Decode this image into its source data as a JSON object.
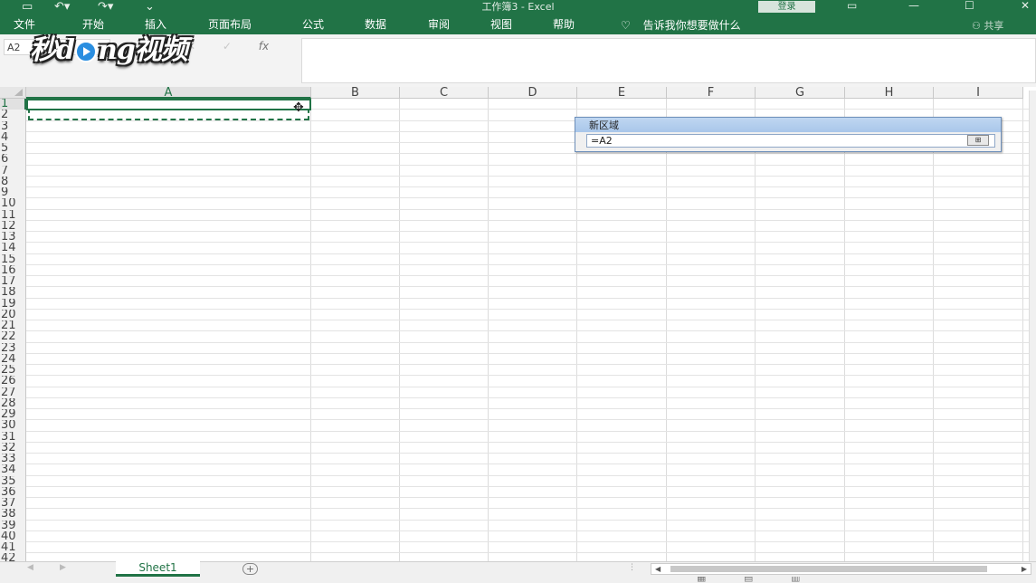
{
  "titlebar": {
    "title": "工作簿3  -  Excel",
    "login_label": "登录",
    "save_icon": "save-icon",
    "undo_icon": "undo-icon",
    "redo_icon": "redo-icon"
  },
  "ribbon": {
    "tabs": [
      "文件",
      "开始",
      "插入",
      "页面布局",
      "公式",
      "数据",
      "审阅",
      "视图",
      "帮助"
    ],
    "tell_me": "告诉我你想要做什么",
    "share": "共享"
  },
  "formula_bar": {
    "name_box": "A2",
    "fx_label": "fx",
    "formula": ""
  },
  "watermark": {
    "text_left": "秒d",
    "text_right": "ng视频"
  },
  "sheet": {
    "columns": [
      "A",
      "B",
      "C",
      "D",
      "E",
      "F",
      "G",
      "H",
      "I"
    ],
    "rows": [
      "1",
      "2",
      "3",
      "4",
      "5",
      "6",
      "7",
      "8",
      "9",
      "10",
      "11",
      "12",
      "13",
      "14",
      "15",
      "16",
      "17",
      "18",
      "19",
      "20",
      "21",
      "22",
      "23",
      "24",
      "25",
      "26",
      "27",
      "28",
      "29",
      "30",
      "31",
      "32",
      "33",
      "34",
      "35",
      "36",
      "37",
      "38",
      "39",
      "40",
      "41",
      "42"
    ],
    "selected_column": "A",
    "selected_row": "1"
  },
  "dialog": {
    "title": "新区域",
    "value": "=A2"
  },
  "sheet_tabs": {
    "active": "Sheet1",
    "add_label": "+"
  },
  "colors": {
    "accent": "#217346",
    "dialog_title": "#b5cfee"
  }
}
